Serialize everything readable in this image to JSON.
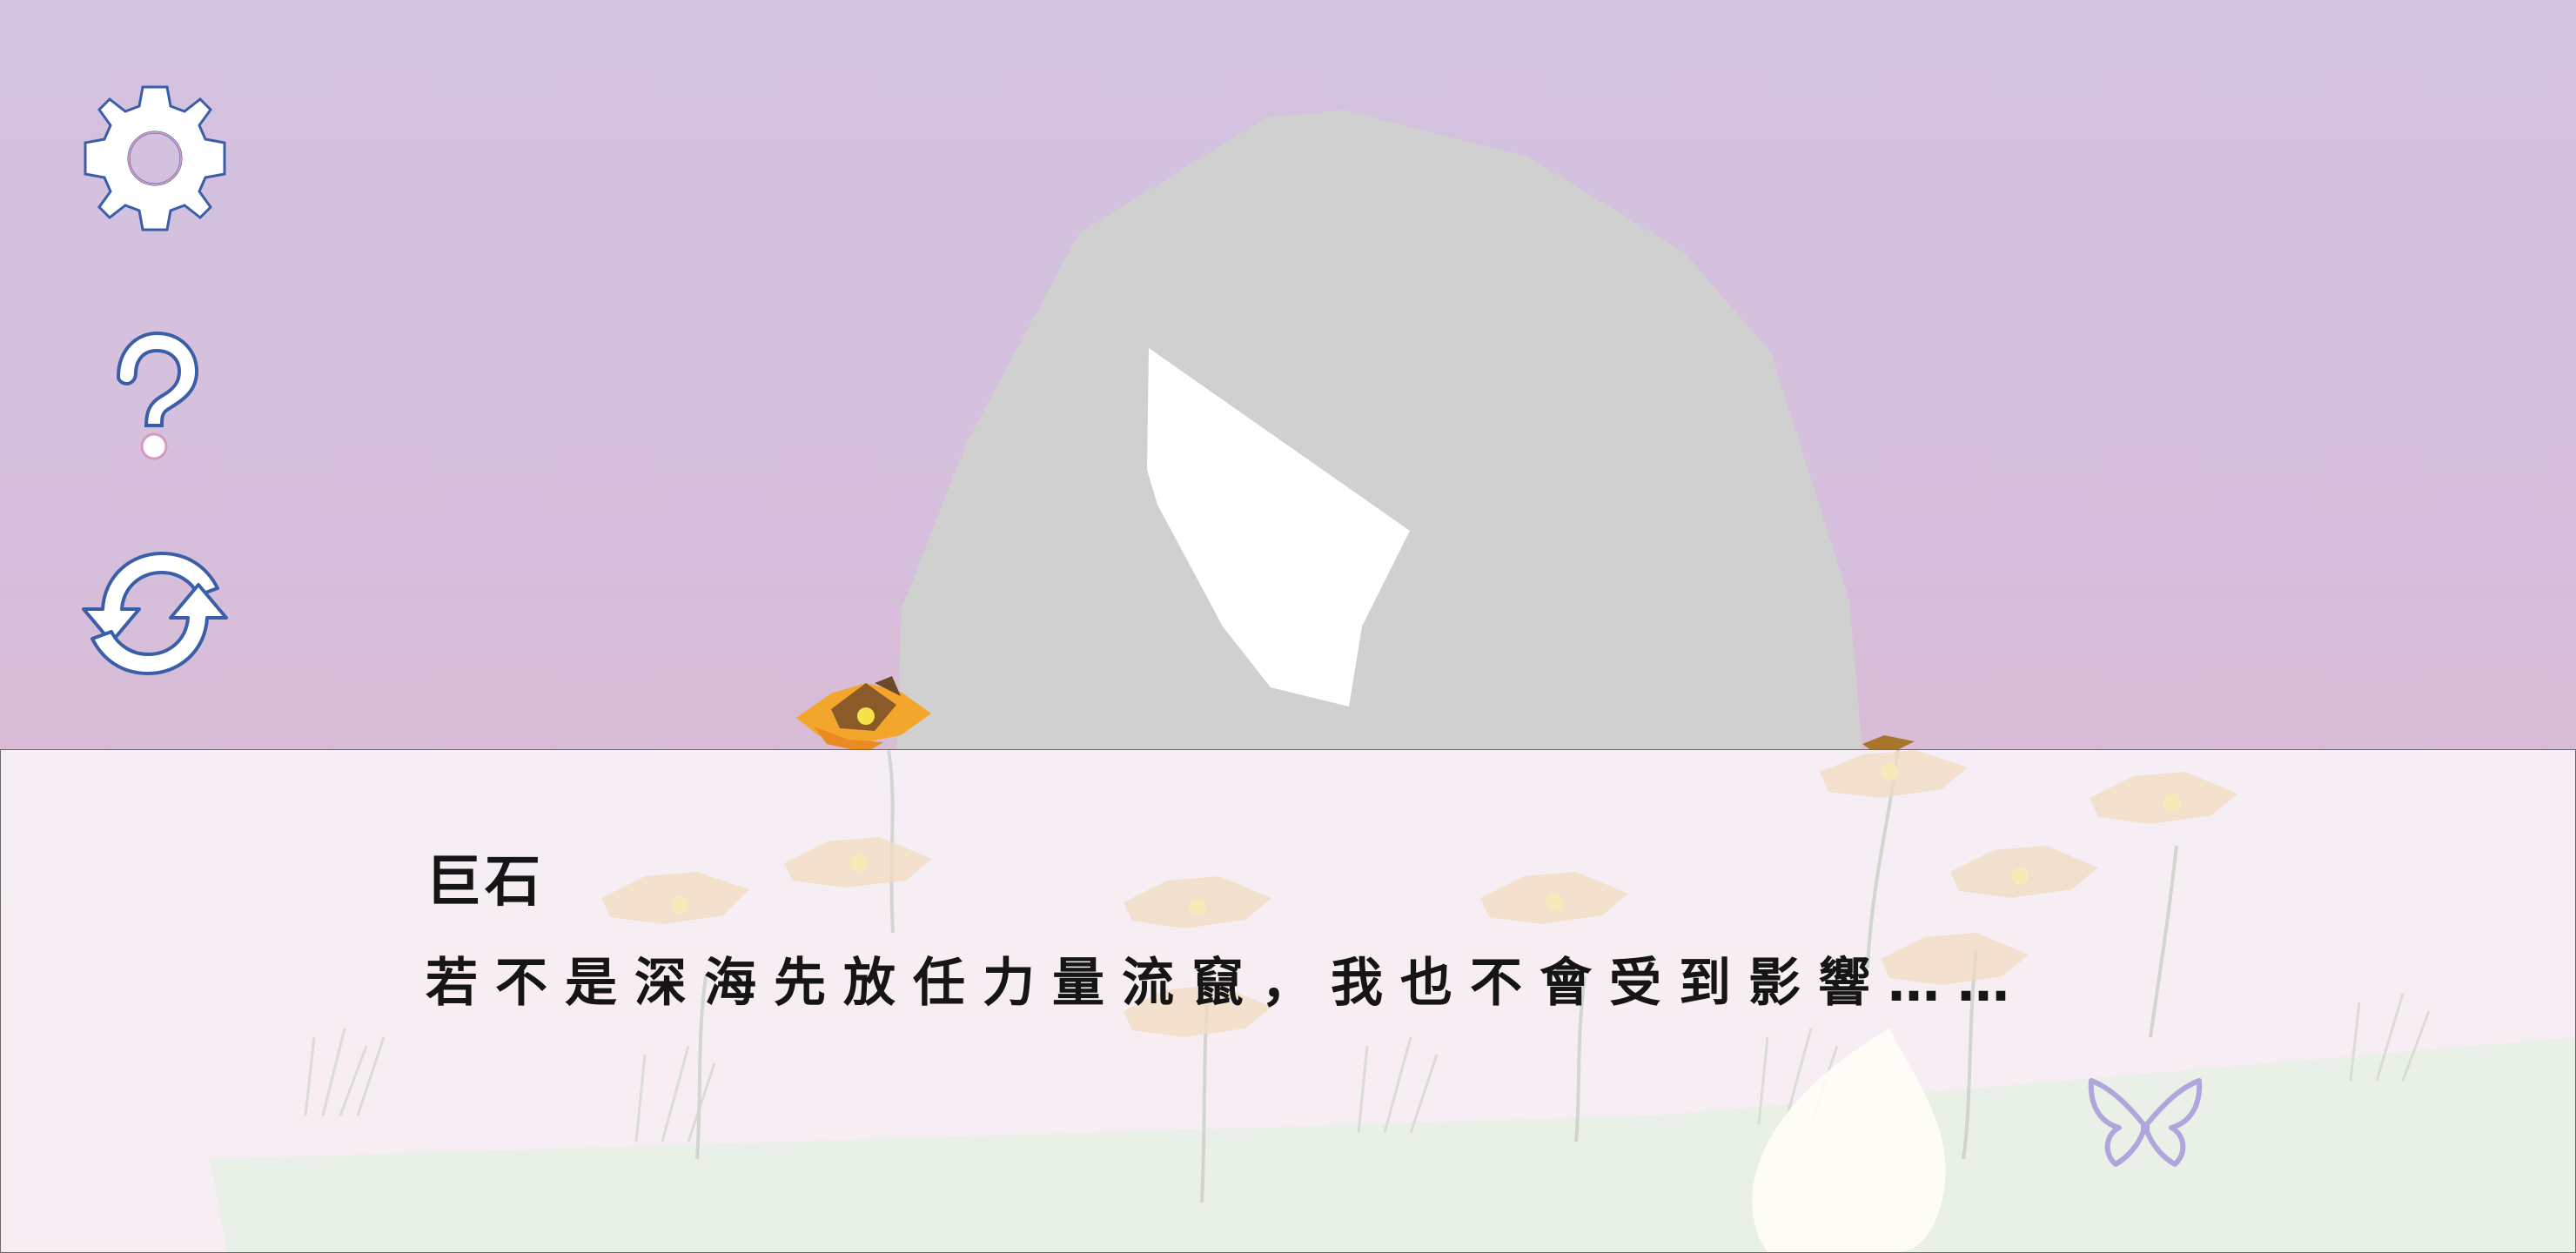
{
  "dialog": {
    "speaker": "巨石",
    "line": "若不是深海先放任力量流竄，我也不會受到影響……"
  },
  "buttons": {
    "settings_icon": "gear-icon",
    "help_icon": "question-icon",
    "restart_icon": "refresh-icon",
    "skip_icon": "butterfly-icon"
  },
  "colors": {
    "sky_top": "#d3c2e0",
    "sky_bottom": "#e0b9c3",
    "rock": "#cfd0cf",
    "icon_outline": "#3b5ea8",
    "butterfly": "#b0a6dc"
  }
}
